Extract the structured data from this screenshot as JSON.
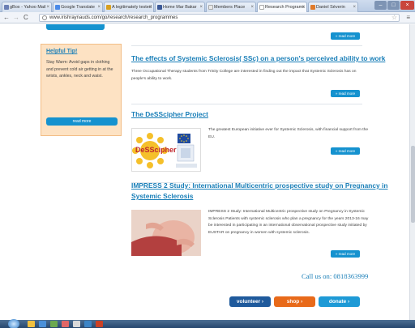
{
  "browser": {
    "tabs": [
      {
        "label": "gBox - Yahoo Mail",
        "active": false
      },
      {
        "label": "Google Translate",
        "active": false
      },
      {
        "label": "A legitimately tested",
        "active": false
      },
      {
        "label": "Home Mar Bakar",
        "active": false
      },
      {
        "label": "Members Place",
        "active": false
      },
      {
        "label": "Research Programs",
        "active": true
      },
      {
        "label": "Daniel Séverin",
        "active": false
      }
    ],
    "url": "www.irishraynauds.com/go/research/research_programmes",
    "star": "☆",
    "menu": "≡"
  },
  "sidebar": {
    "tip_title": "Helpful Tip!",
    "tip_text": "Stay Warm: Avoid gaps in clothing and prevent cold air getting in at the wrists, ankles, neck and waist.",
    "tip_button": "read more"
  },
  "articles": {
    "readmore_label": "» read more",
    "a1": {
      "title": "The effects of Systemic Sclerosis( SSc) on a person's perceived ability to work",
      "text": "Three Occupational Therapy students from Trinity College are interested in finding out the impact that Systemic Sclerosis has on people's ability to work."
    },
    "a2": {
      "title": "The DeSScipher Project",
      "text": "The greatest European initiative ever for Systemic Sclerosis, with financial support from the EU.",
      "logo_text": "DeSScipher"
    },
    "a3": {
      "title_line1": "IMPRESS 2 Study: International Multicentric prospective study on Pregnancy in",
      "title_line2": "Systemic Sclerosis",
      "text": "IMPRESS 2 Study: International Multicentric prospective study on Pregnancy in Systemic Sclerosis Patients with systemic sclerosis who plan a pregnancy for the years 2013-16 may be interested in participating in an international observational prospective study initiated by EUSTAR on pregnancy in women with systemic sclerosis."
    }
  },
  "footer": {
    "phone": "Call us on: 0818363999",
    "volunteer": "volunteer ›",
    "shop": "shop ›",
    "donate": "donate ›"
  },
  "colors": {
    "link_blue": "#1a7fb8",
    "button_blue": "#1592cf",
    "volunteer": "#1f5a9c",
    "shop": "#e86a1a",
    "donate": "#1e9ad6",
    "tip_bg": "#fde2c3"
  }
}
